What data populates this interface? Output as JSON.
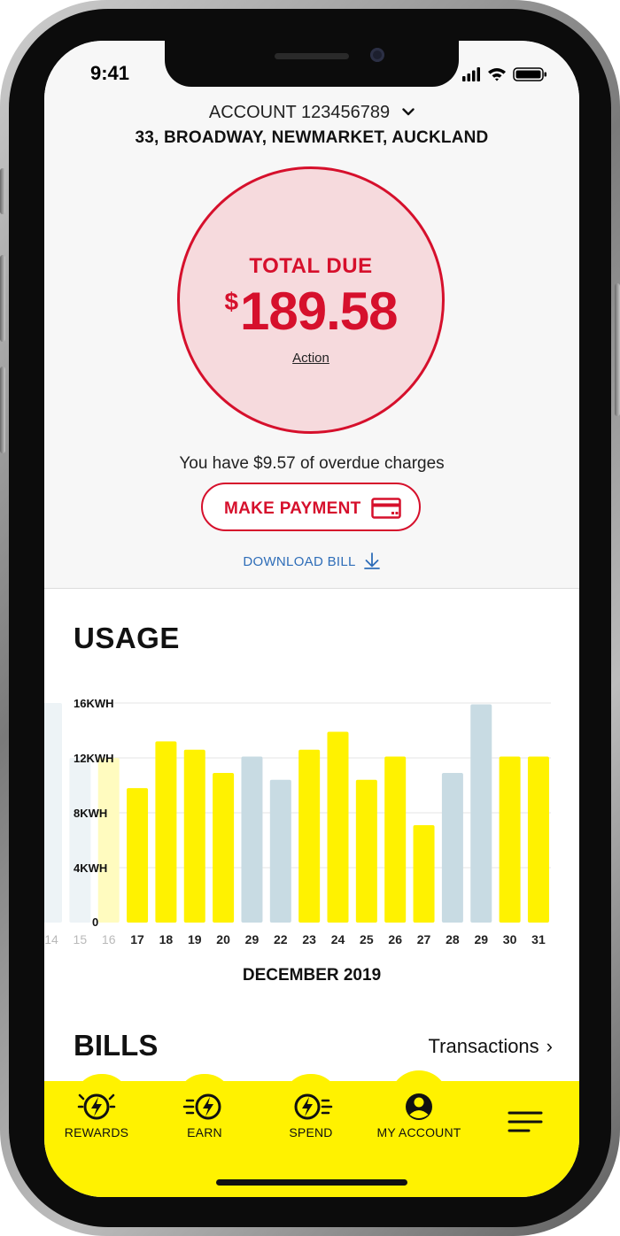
{
  "status_bar": {
    "time": "9:41"
  },
  "account": {
    "label": "ACCOUNT 123456789",
    "address": "33, BROADWAY, NEWMARKET, AUCKLAND"
  },
  "due": {
    "label": "TOTAL DUE",
    "currency": "$",
    "amount": "189.58",
    "action_link": "Action"
  },
  "overdue_text": "You have $9.57 of overdue charges",
  "make_payment_label": "MAKE PAYMENT",
  "download_bill_label": "DOWNLOAD BILL",
  "usage": {
    "title": "USAGE",
    "month_label": "DECEMBER 2019"
  },
  "bills": {
    "title": "BILLS",
    "transactions_label": "Transactions"
  },
  "nav": {
    "items": [
      {
        "label": "REWARDS",
        "icon": "rewards-bolt-icon"
      },
      {
        "label": "EARN",
        "icon": "earn-bolt-icon"
      },
      {
        "label": "SPEND",
        "icon": "spend-bolt-icon"
      },
      {
        "label": "MY ACCOUNT",
        "icon": "account-user-icon",
        "active": true
      },
      {
        "label": "",
        "icon": "menu-icon"
      }
    ]
  },
  "colors": {
    "accent_red": "#d6102c",
    "nav_yellow": "#fff200",
    "bar_yellow": "#fff200",
    "bar_blue": "#c8dbe3",
    "link_blue": "#2e6db8"
  },
  "chart_data": {
    "type": "bar",
    "y_unit": "KWH",
    "ylim": [
      0,
      16
    ],
    "y_ticks": [
      "16KWH",
      "12KWH",
      "8KWH",
      "4KWH",
      "0"
    ],
    "categories": [
      "14",
      "15",
      "16",
      "17",
      "18",
      "19",
      "20",
      "29",
      "22",
      "23",
      "24",
      "25",
      "26",
      "27",
      "28",
      "29",
      "30",
      "31"
    ],
    "values": [
      16,
      12,
      12,
      9.8,
      13.2,
      12.6,
      10.9,
      12.1,
      10.4,
      12.6,
      13.9,
      10.4,
      12.1,
      7.1,
      10.9,
      15.9,
      12.1,
      12.1
    ],
    "bar_kind": [
      "faded",
      "faded",
      "faded-yellow",
      "yellow",
      "yellow",
      "yellow",
      "yellow",
      "blue",
      "blue",
      "yellow",
      "yellow",
      "yellow",
      "yellow",
      "yellow",
      "blue",
      "blue",
      "yellow",
      "yellow"
    ],
    "grid": true,
    "xlabel": "DECEMBER 2019"
  }
}
